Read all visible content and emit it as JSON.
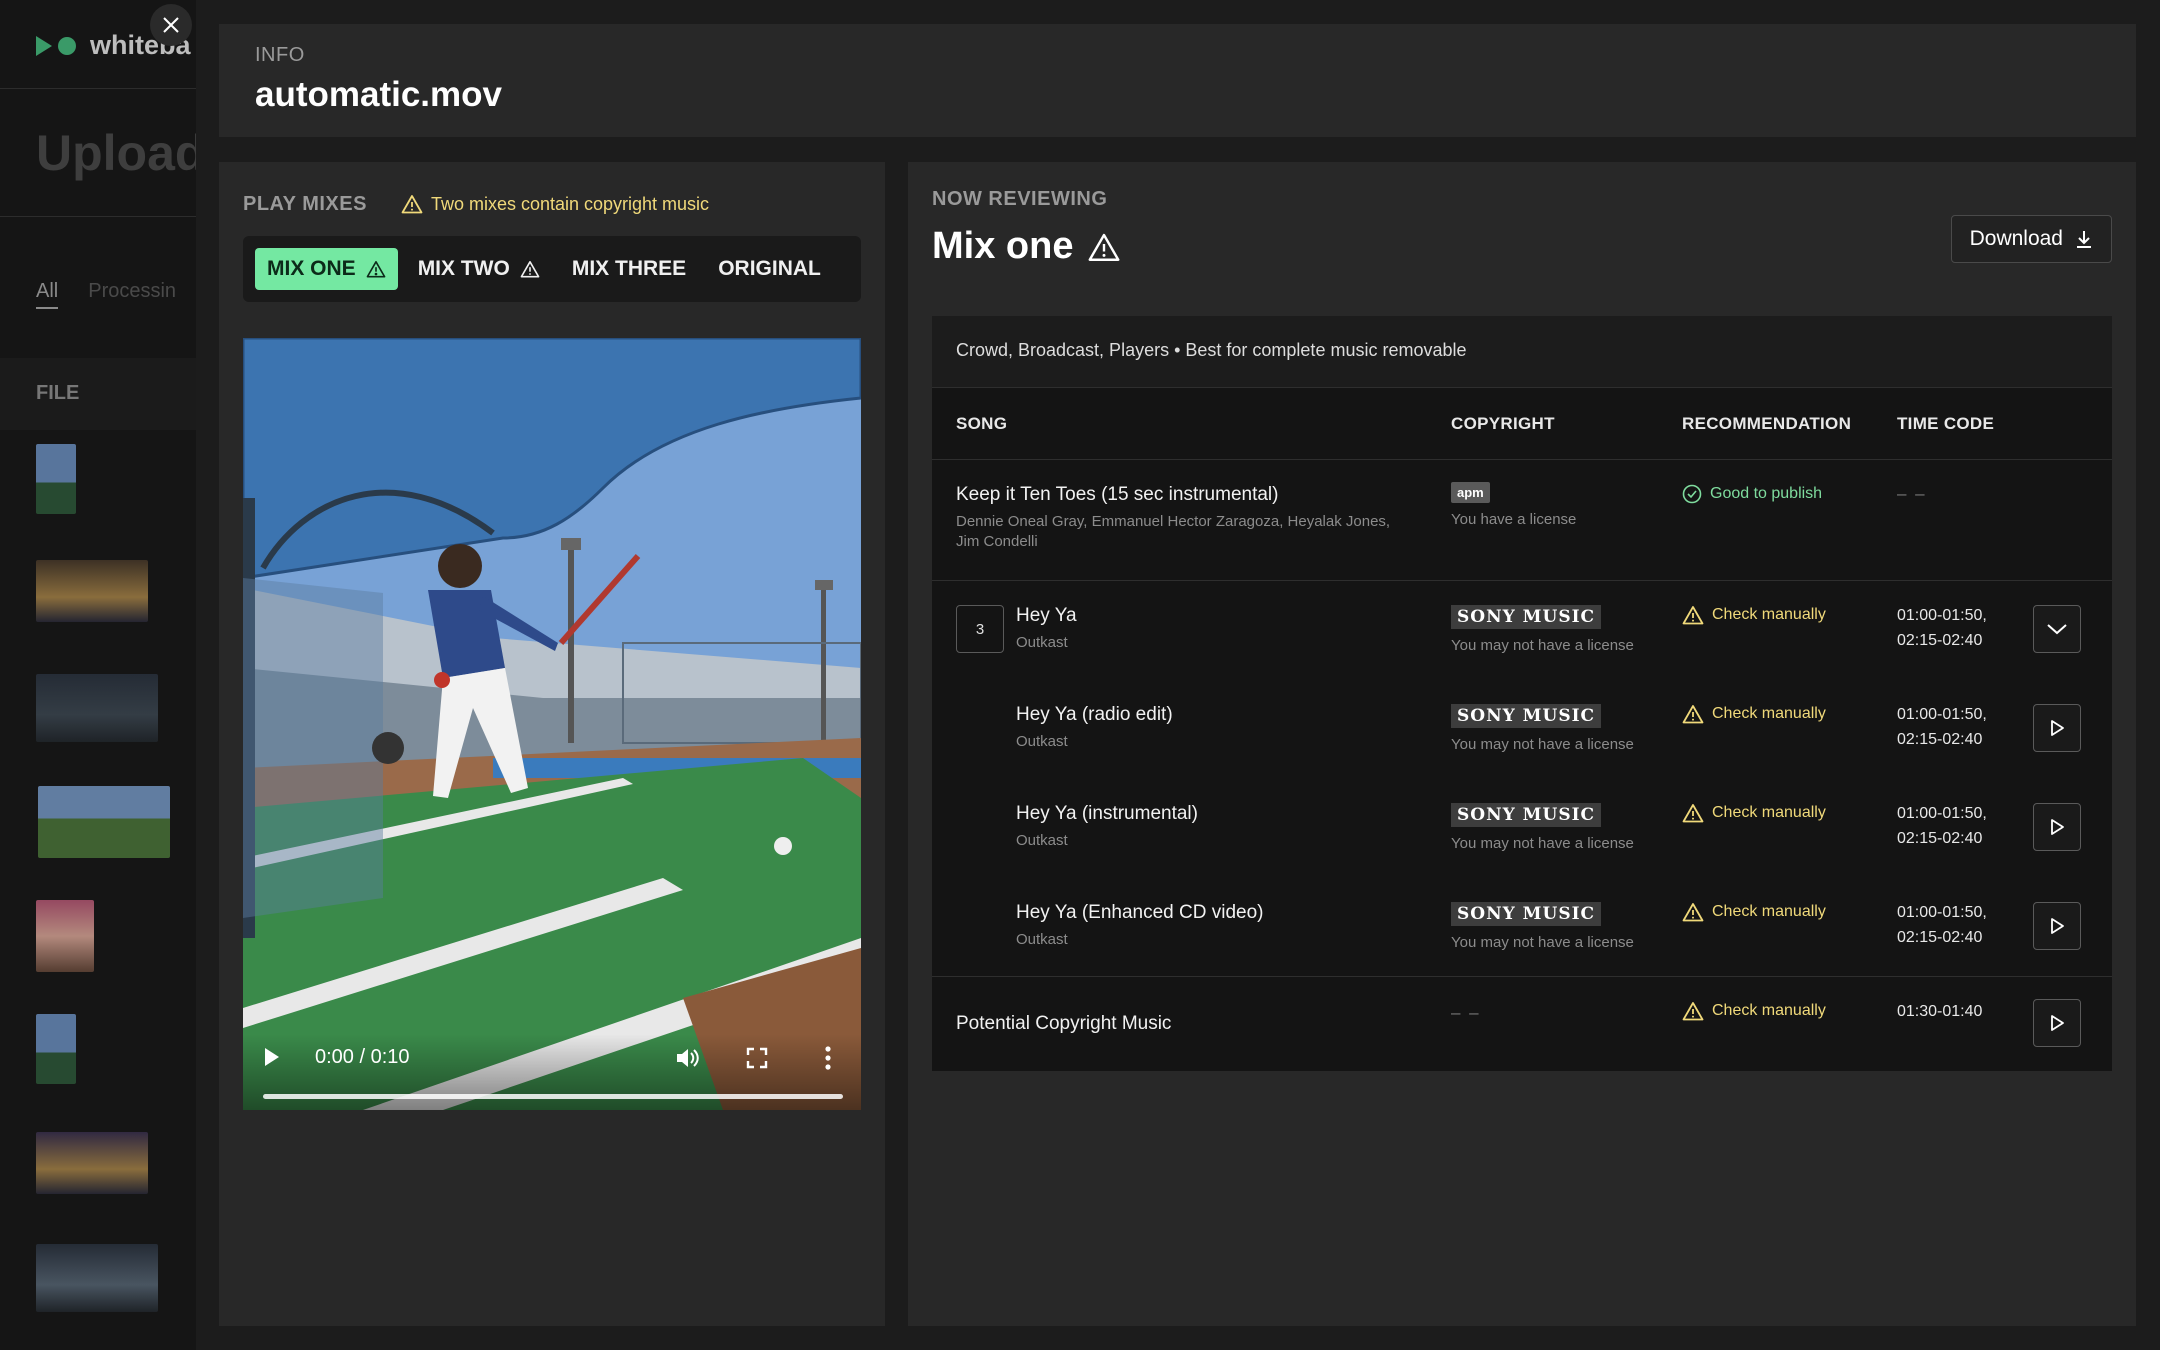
{
  "background": {
    "logo_text": "whiteba",
    "page_title": "Upload",
    "tabs": [
      "All",
      "Processin"
    ],
    "file_header": "FILE"
  },
  "info": {
    "label": "INFO",
    "filename": "automatic.mov"
  },
  "mixes": {
    "label": "PLAY MIXES",
    "warning": "Two mixes contain copyright music",
    "tabs": [
      {
        "label": "MIX ONE",
        "warn": true,
        "active": true
      },
      {
        "label": "MIX TWO",
        "warn": true,
        "active": false
      },
      {
        "label": "MIX THREE",
        "warn": false,
        "active": false
      },
      {
        "label": "ORIGINAL",
        "warn": false,
        "active": false
      }
    ]
  },
  "player": {
    "time": "0:00 / 0:10",
    "progress": 0
  },
  "review": {
    "label": "NOW REVIEWING",
    "title": "Mix one",
    "download_label": "Download",
    "description": "Crowd, Broadcast, Players • Best for complete music removable",
    "columns": [
      "SONG",
      "COPYRIGHT",
      "RECOMMENDATION",
      "TIME CODE"
    ],
    "rows": [
      {
        "title": "Keep it Ten Toes (15 sec instrumental)",
        "artists": "Dennie Oneal Gray,  Emmanuel Hector Zaragoza, Heyalak Jones, Jim Condelli",
        "label_logo": "apm",
        "license": "You have a license",
        "recommendation": "Good to publish",
        "time_code": "– –"
      },
      {
        "count": "3",
        "title": "Hey Ya",
        "artists": "Outkast",
        "label_logo": "SONY MUSIC",
        "license": "You may not have a license",
        "recommendation": "Check manually",
        "time_code_1": "01:00-01:50,",
        "time_code_2": "02:15-02:40"
      },
      {
        "title": "Hey Ya (radio edit)",
        "artists": "Outkast",
        "label_logo": "SONY MUSIC",
        "license": "You may not have a license",
        "recommendation": "Check manually",
        "time_code_1": "01:00-01:50,",
        "time_code_2": "02:15-02:40"
      },
      {
        "title": "Hey Ya (instrumental)",
        "artists": "Outkast",
        "label_logo": "SONY MUSIC",
        "license": "You may not have a license",
        "recommendation": "Check manually",
        "time_code_1": "01:00-01:50,",
        "time_code_2": "02:15-02:40"
      },
      {
        "title": "Hey Ya (Enhanced CD video)",
        "artists": "Outkast",
        "label_logo": "SONY MUSIC",
        "license": "You may not have a license",
        "recommendation": "Check manually",
        "time_code_1": "01:00-01:50,",
        "time_code_2": "02:15-02:40"
      },
      {
        "title": "Potential Copyright Music",
        "copyright": "– –",
        "recommendation": "Check manually",
        "time_code": "01:30-01:40"
      }
    ]
  },
  "colors": {
    "accent_green": "#74e8a2",
    "warning_yellow": "#f0d97a",
    "ok_green": "#7fdc9e"
  }
}
